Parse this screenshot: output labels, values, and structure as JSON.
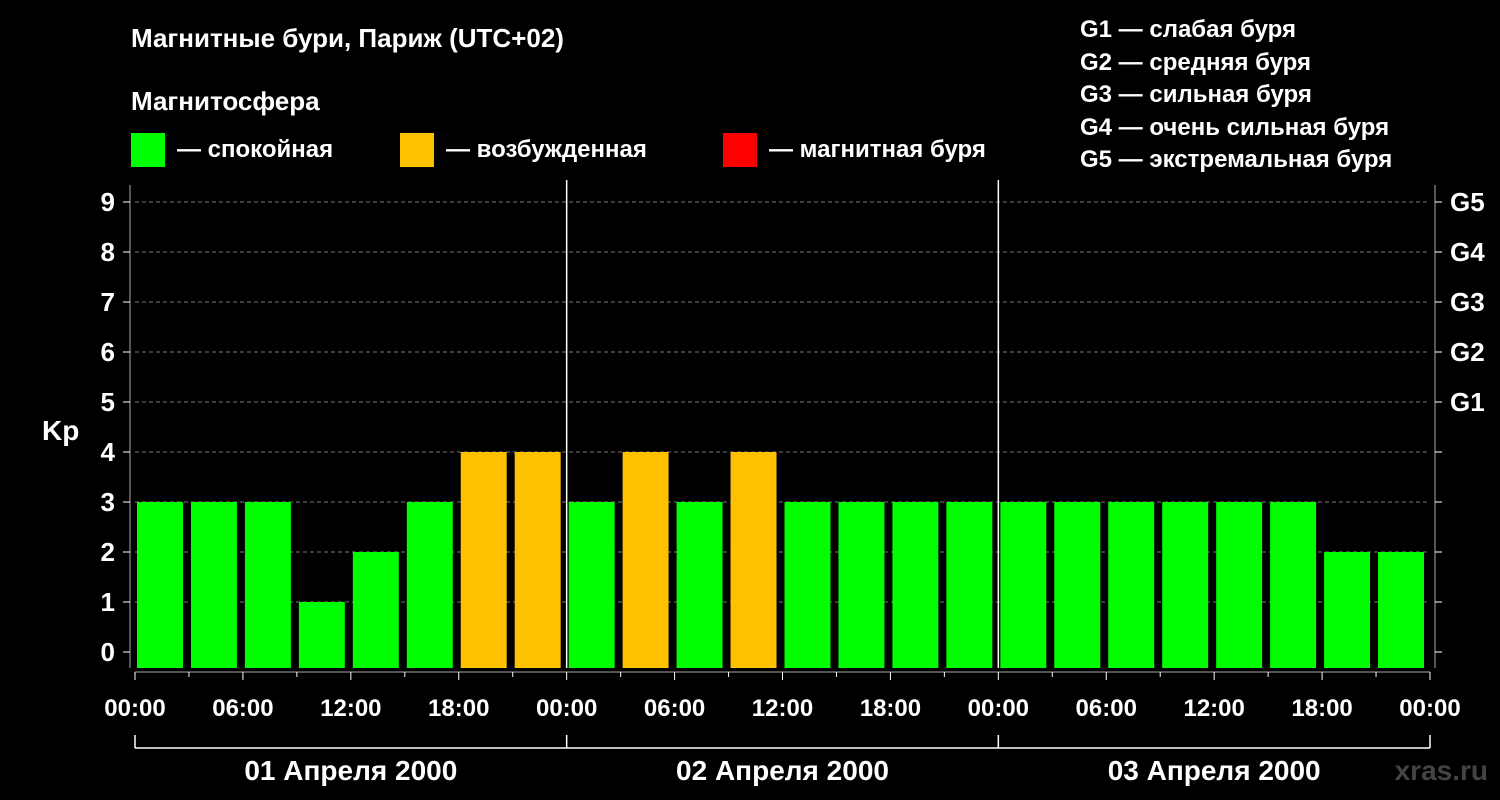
{
  "header": {
    "title": "Магнитные бури, Париж (UTC+02)",
    "subtitle": "Магнитосфера"
  },
  "legend": [
    {
      "label": "— спокойная",
      "color": "#00ff00"
    },
    {
      "label": "— возбужденная",
      "color": "#ffc000"
    },
    {
      "label": "— магнитная буря",
      "color": "#ff0000"
    }
  ],
  "g_scale": [
    "G1 — слабая буря",
    "G2 — средняя буря",
    "G3 — сильная буря",
    "G4 — очень сильная буря",
    "G5 — экстремальная буря"
  ],
  "watermark": "xras.ru",
  "chart_data": {
    "type": "bar",
    "ylabel": "Kp",
    "ylim": [
      0,
      9
    ],
    "y_ticks": [
      "0",
      "1",
      "2",
      "3",
      "4",
      "5",
      "6",
      "7",
      "8",
      "9"
    ],
    "right_axis_labels": [
      {
        "kp": 5,
        "label": "G1"
      },
      {
        "kp": 6,
        "label": "G2"
      },
      {
        "kp": 7,
        "label": "G3"
      },
      {
        "kp": 8,
        "label": "G4"
      },
      {
        "kp": 9,
        "label": "G5"
      }
    ],
    "x_tick_labels": [
      "00:00",
      "06:00",
      "12:00",
      "18:00",
      "00:00",
      "06:00",
      "12:00",
      "18:00",
      "00:00",
      "06:00",
      "12:00",
      "18:00",
      "00:00"
    ],
    "days": [
      "01 Апреля 2000",
      "02 Апреля 2000",
      "03 Апреля 2000"
    ],
    "grid": true,
    "series": [
      {
        "interval_hours": 3,
        "values": [
          3,
          3,
          3,
          1,
          2,
          3,
          4,
          4,
          3,
          4,
          3,
          4,
          3,
          3,
          3,
          3,
          3,
          3,
          3,
          3,
          3,
          3,
          2,
          2
        ],
        "levels": [
          "спокойная",
          "спокойная",
          "спокойная",
          "спокойная",
          "спокойная",
          "спокойная",
          "возбужденная",
          "возбужденная",
          "спокойная",
          "возбужденная",
          "спокойная",
          "возбужденная",
          "спокойная",
          "спокойная",
          "спокойная",
          "спокойная",
          "спокойная",
          "спокойная",
          "спокойная",
          "спокойная",
          "спокойная",
          "спокойная",
          "спокойная",
          "спокойная"
        ]
      }
    ]
  }
}
